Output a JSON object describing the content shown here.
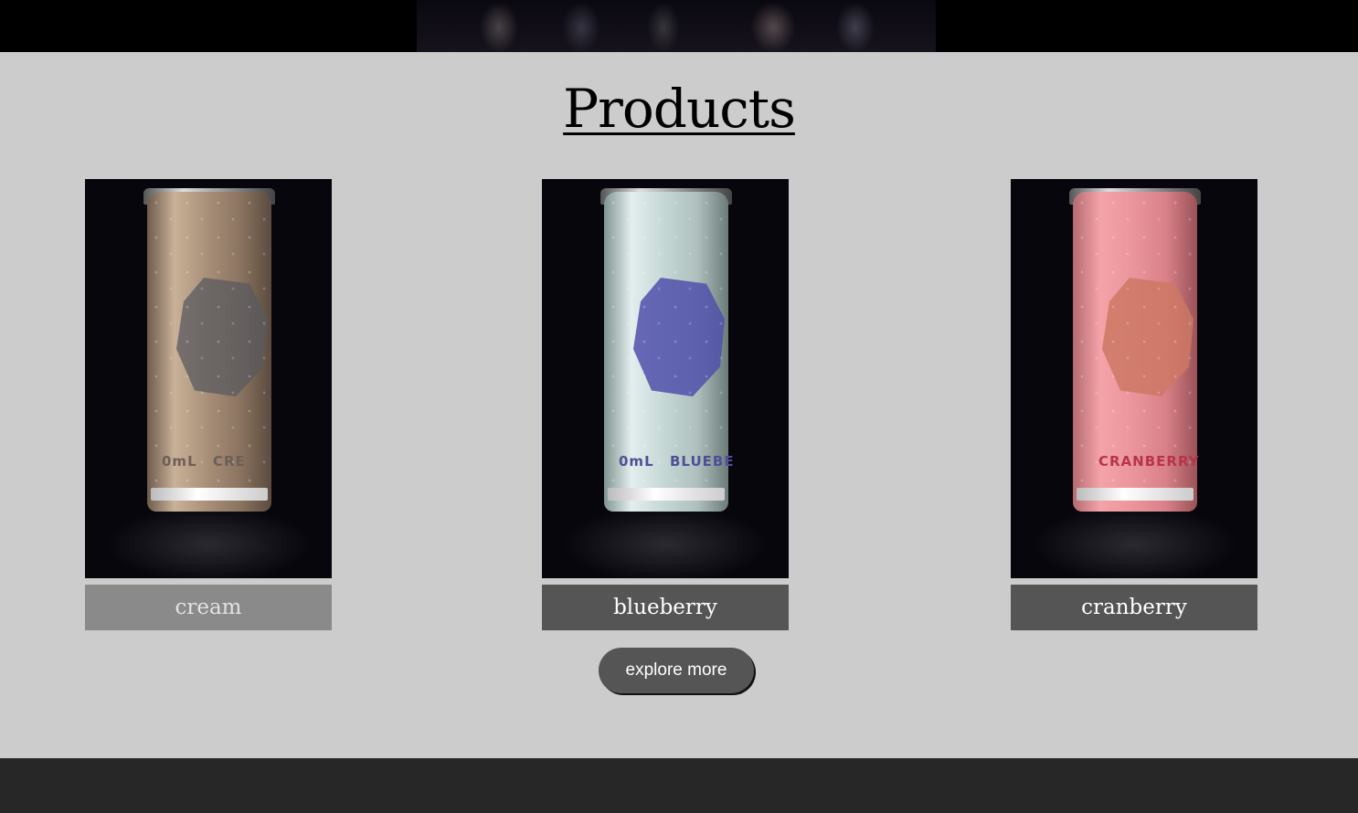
{
  "page": {
    "title": "Products"
  },
  "products": [
    {
      "name": "cream",
      "can_volume": "0mL",
      "can_flavor": "CRE"
    },
    {
      "name": "blueberry",
      "can_volume": "0mL",
      "can_flavor": "BLUEBE"
    },
    {
      "name": "cranberry",
      "can_volume": "",
      "can_flavor": "CRANBERRY"
    }
  ],
  "actions": {
    "explore_label": "explore more"
  },
  "colors": {
    "background": "#cccccc",
    "label_bg": "#555555",
    "label_bg_dim": "#8a8a8a",
    "footer": "#272727"
  }
}
